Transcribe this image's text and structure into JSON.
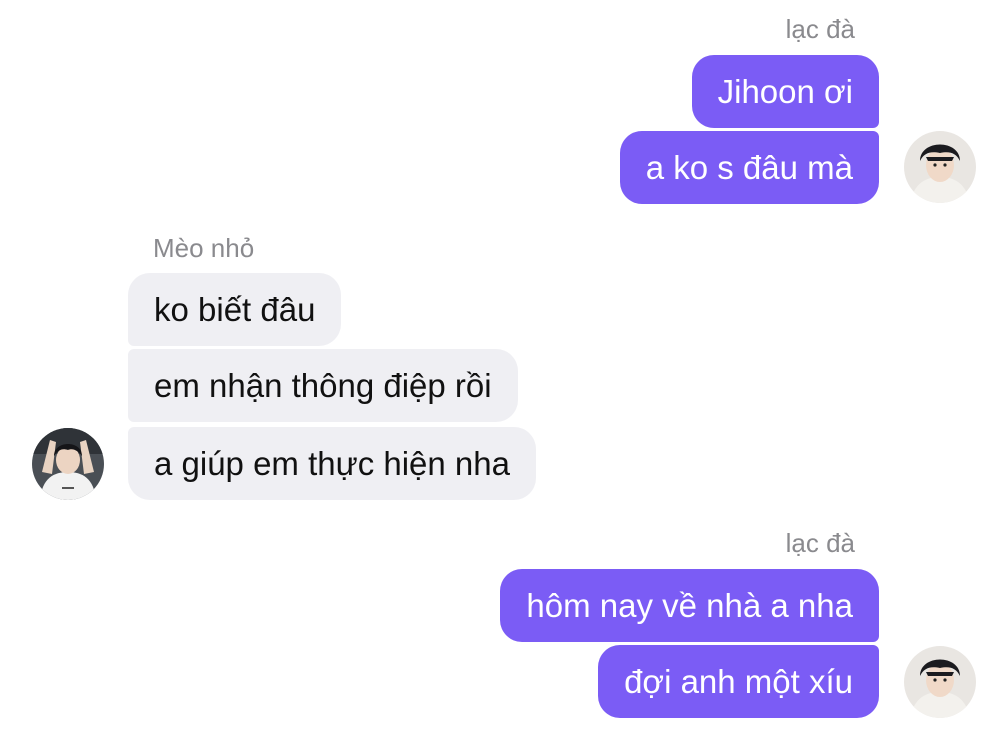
{
  "messages": [
    {
      "sender": "lạc đà",
      "texts": [
        "Jihoon ơi",
        "a ko s đâu mà"
      ]
    },
    {
      "sender": "Mèo nhỏ",
      "texts": [
        "ko biết đâu",
        "em nhận thông điệp rồi",
        "a giúp em thực hiện nha"
      ]
    },
    {
      "sender": "lạc đà",
      "texts": [
        "hôm nay về nhà a nha",
        "đợi anh một xíu"
      ]
    }
  ],
  "colors": {
    "outgoing_bubble": "#7b5cf5",
    "incoming_bubble": "#efeff3",
    "sender_label": "#8a8a8e"
  }
}
